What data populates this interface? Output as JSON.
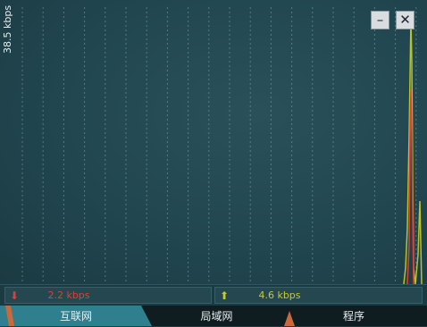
{
  "graph": {
    "scale_label": "38.5 kbps"
  },
  "window_controls": {
    "minimize_label": "–",
    "close_label": "✕"
  },
  "status": {
    "download": {
      "arrow": "⬇",
      "value": "2.2 kbps",
      "color": "#d9423a"
    },
    "upload": {
      "arrow": "⬆",
      "value": "4.6 kbps",
      "color": "#c6cc2e"
    }
  },
  "tabs": [
    {
      "label": "互联网",
      "active": true
    },
    {
      "label": "局域网",
      "active": false
    },
    {
      "label": "程序",
      "active": false
    }
  ],
  "colors": {
    "background": "#1f3d45",
    "grid": "#7fa3a6",
    "download_line": "#d9423a",
    "upload_line": "#b8c22a",
    "active_tab": "#2f7f8f"
  }
}
